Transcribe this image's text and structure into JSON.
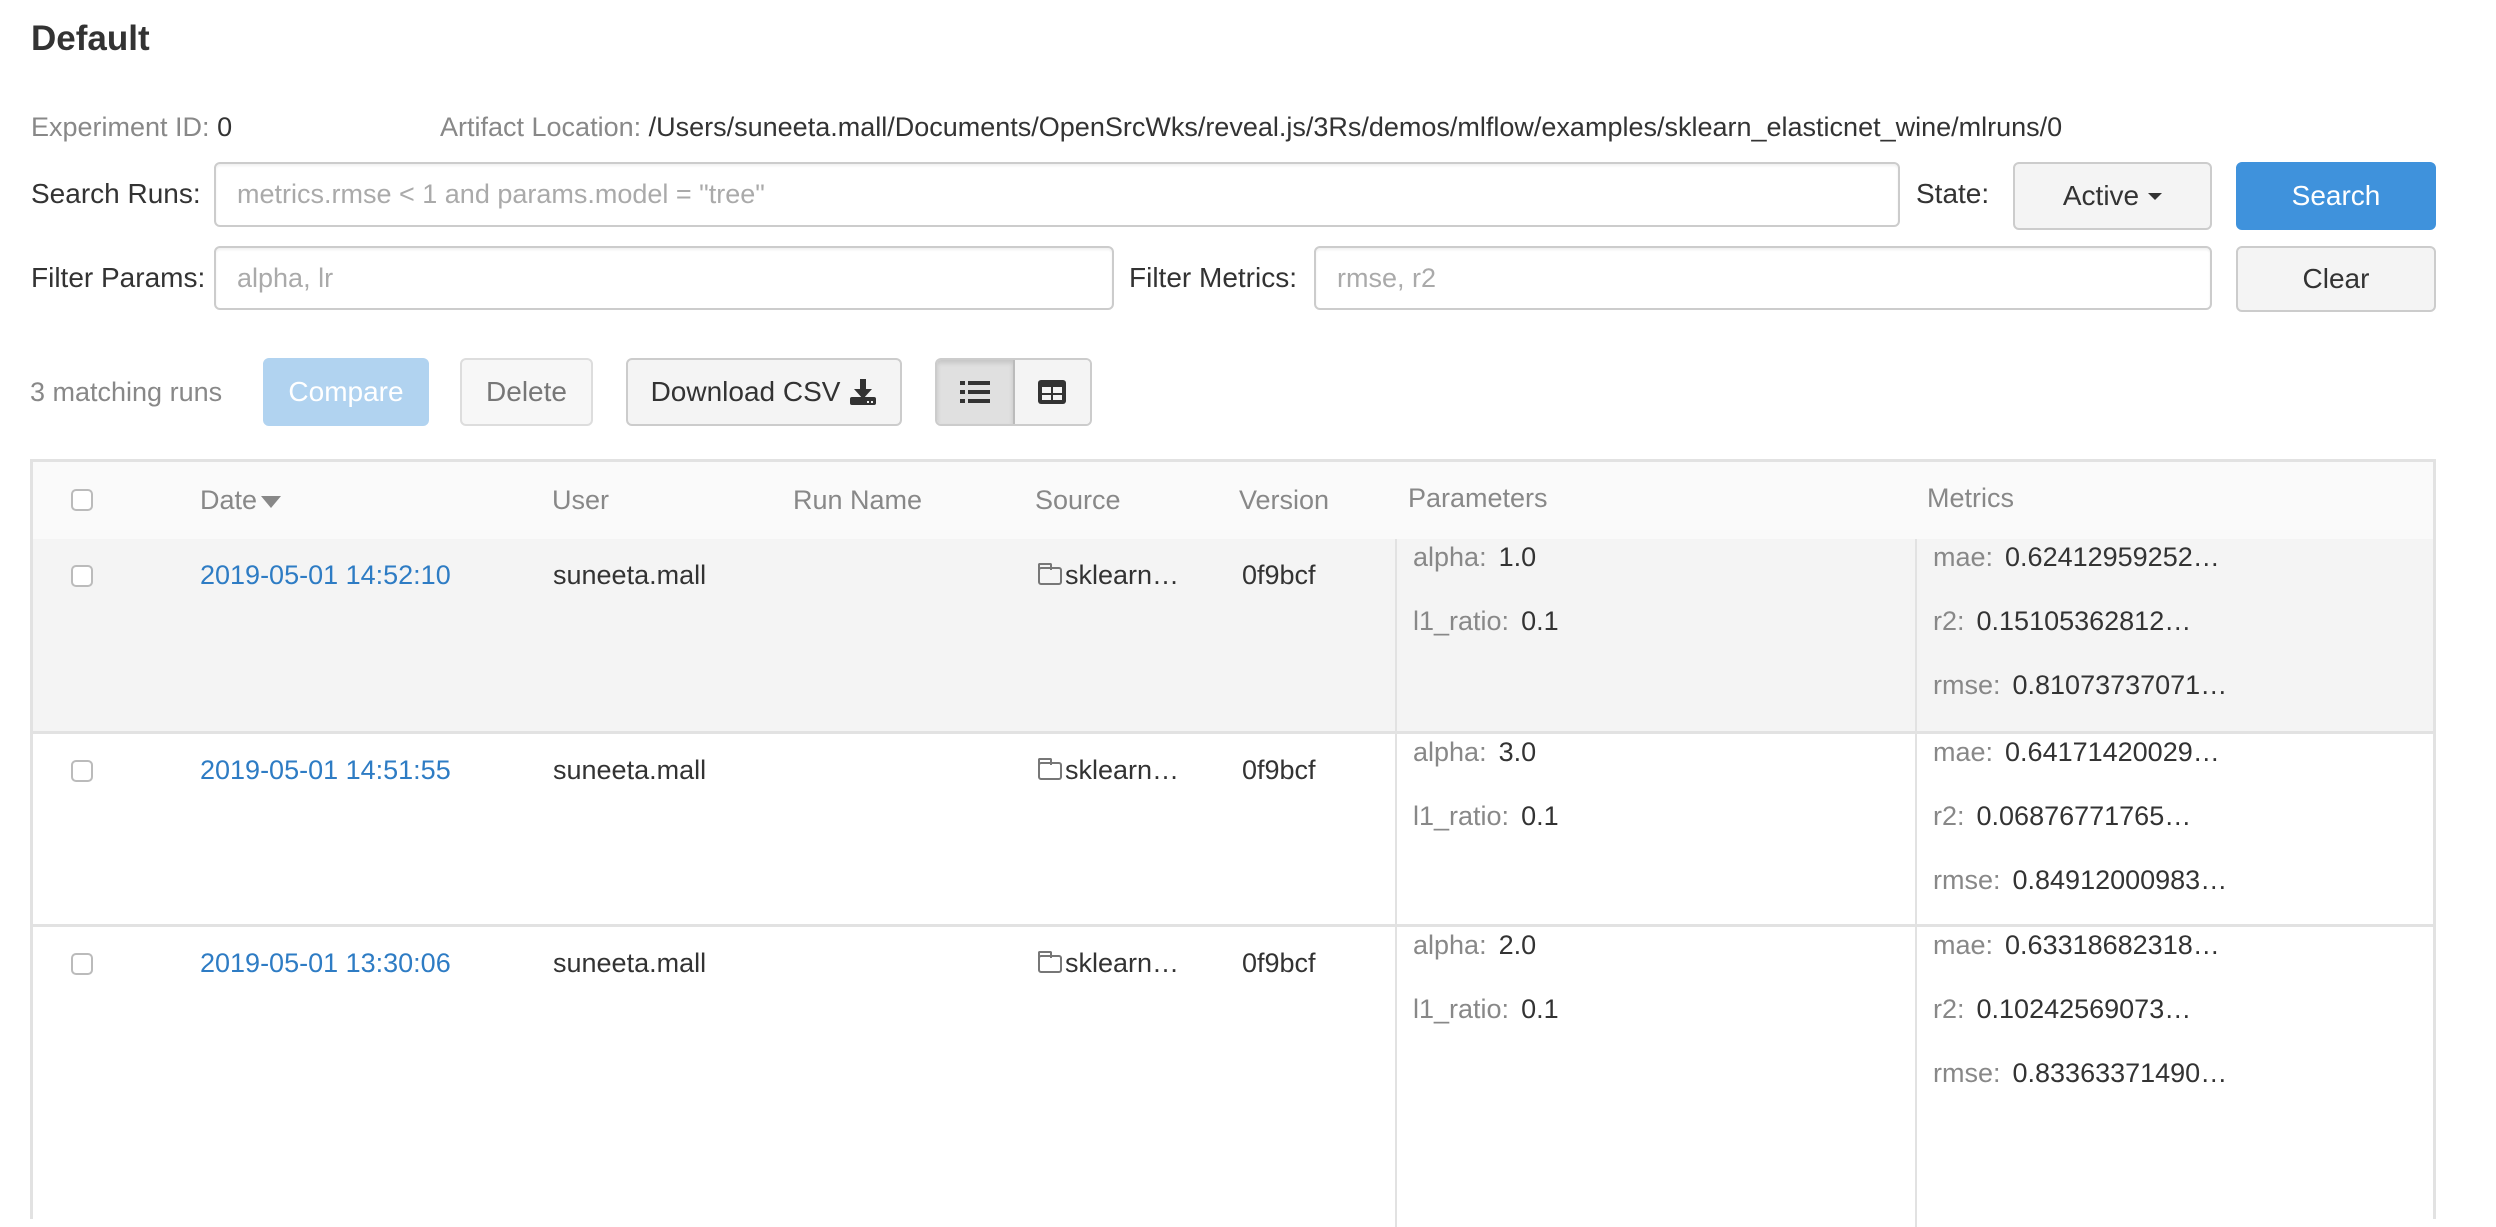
{
  "page": {
    "title": "Default",
    "experiment_id_label": "Experiment ID:",
    "experiment_id": "0",
    "artifact_location_label": "Artifact Location:",
    "artifact_location": "/Users/suneeta.mall/Documents/OpenSrcWks/reveal.js/3Rs/demos/mlflow/examples/sklearn_elasticnet_wine/mlruns/0"
  },
  "search": {
    "label": "Search Runs:",
    "value": "",
    "placeholder": "metrics.rmse < 1 and params.model = \"tree\"",
    "state_label": "State:",
    "state_value": "Active",
    "search_button": "Search",
    "filter_params_label": "Filter Params:",
    "filter_params_value": "",
    "filter_params_placeholder": "alpha, lr",
    "filter_metrics_label": "Filter Metrics:",
    "filter_metrics_value": "",
    "filter_metrics_placeholder": "rmse, r2",
    "clear_button": "Clear"
  },
  "toolbar": {
    "matching_runs": "3 matching runs",
    "compare_button": "Compare",
    "delete_button": "Delete",
    "download_button": "Download CSV",
    "view_list_icon": "list-icon",
    "view_grid_icon": "grid-icon",
    "active_view": "list"
  },
  "table": {
    "columns": [
      "Date",
      "User",
      "Run Name",
      "Source",
      "Version",
      "Parameters",
      "Metrics"
    ],
    "sort_column": "Date",
    "sort_direction": "descending",
    "rows": [
      {
        "date": "2019-05-01 14:52:10",
        "user": "suneeta.mall",
        "run_name": "",
        "source": "sklearn…",
        "version": "0f9bcf",
        "params": [
          {
            "key": "alpha:",
            "value": "1.0"
          },
          {
            "key": "l1_ratio:",
            "value": "0.1"
          }
        ],
        "metrics": [
          {
            "key": "mae:",
            "value": "0.62412959252…"
          },
          {
            "key": "r2:",
            "value": "0.15105362812…"
          },
          {
            "key": "rmse:",
            "value": "0.81073737071…"
          }
        ]
      },
      {
        "date": "2019-05-01 14:51:55",
        "user": "suneeta.mall",
        "run_name": "",
        "source": "sklearn…",
        "version": "0f9bcf",
        "params": [
          {
            "key": "alpha:",
            "value": "3.0"
          },
          {
            "key": "l1_ratio:",
            "value": "0.1"
          }
        ],
        "metrics": [
          {
            "key": "mae:",
            "value": "0.64171420029…"
          },
          {
            "key": "r2:",
            "value": "0.06876771765…"
          },
          {
            "key": "rmse:",
            "value": "0.84912000983…"
          }
        ]
      },
      {
        "date": "2019-05-01 13:30:06",
        "user": "suneeta.mall",
        "run_name": "",
        "source": "sklearn…",
        "version": "0f9bcf",
        "params": [
          {
            "key": "alpha:",
            "value": "2.0"
          },
          {
            "key": "l1_ratio:",
            "value": "0.1"
          }
        ],
        "metrics": [
          {
            "key": "mae:",
            "value": "0.63318682318…"
          },
          {
            "key": "r2:",
            "value": "0.10242569073…"
          },
          {
            "key": "rmse:",
            "value": "0.83363371490…"
          }
        ]
      }
    ]
  },
  "colors": {
    "primary": "#3f92dc",
    "primary_disabled": "#b1d3f0",
    "link": "#2e7cc4",
    "label_gray": "#888888",
    "text": "#333333"
  }
}
